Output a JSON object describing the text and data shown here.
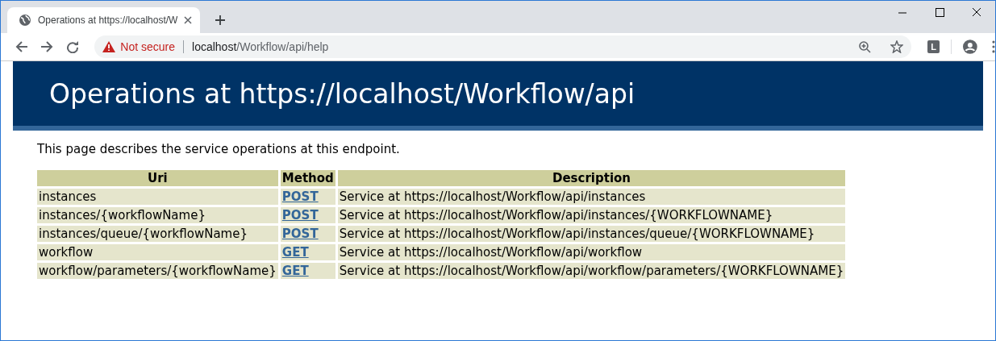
{
  "browser": {
    "tab_title": "Operations at https://localhost/W",
    "security_label": "Not secure",
    "url_host": "localhost",
    "url_path": "/Workflow/api/help",
    "profile_letter": "L"
  },
  "page": {
    "heading": "Operations at https://localhost/Workflow/api",
    "intro": "This page describes the service operations at this endpoint.",
    "table": {
      "columns": [
        "Uri",
        "Method",
        "Description"
      ],
      "rows": [
        {
          "uri": "instances",
          "method": "POST",
          "description": "Service at https://localhost/Workflow/api/instances"
        },
        {
          "uri": "instances/{workflowName}",
          "method": "POST",
          "description": "Service at https://localhost/Workflow/api/instances/{WORKFLOWNAME}"
        },
        {
          "uri": "instances/queue/{workflowName}",
          "method": "POST",
          "description": "Service at https://localhost/Workflow/api/instances/queue/{WORKFLOWNAME}"
        },
        {
          "uri": "workflow",
          "method": "GET",
          "description": "Service at https://localhost/Workflow/api/workflow"
        },
        {
          "uri": "workflow/parameters/{workflowName}",
          "method": "GET",
          "description": "Service at https://localhost/Workflow/api/workflow/parameters/{WORKFLOWNAME}"
        }
      ]
    }
  }
}
